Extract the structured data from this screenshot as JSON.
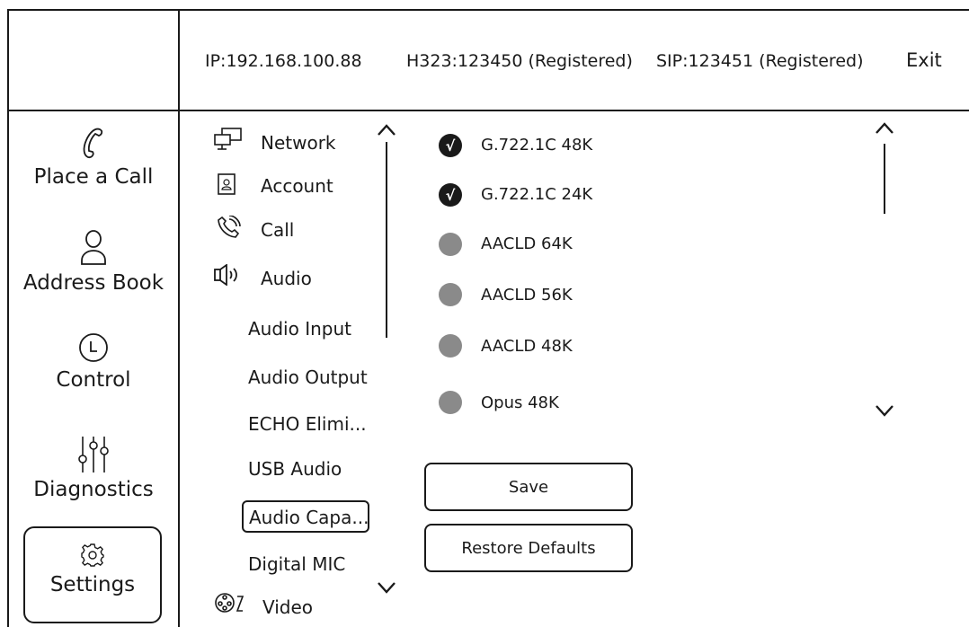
{
  "header": {
    "ip": "IP:192.168.100.88",
    "h323": "H323:123450 (Registered)",
    "sip": "SIP:123451 (Registered)",
    "exit_label": "Exit"
  },
  "nav": {
    "items": [
      {
        "label": "Place a Call",
        "icon": "phone-icon"
      },
      {
        "label": "Address Book",
        "icon": "person-icon"
      },
      {
        "label": "Control",
        "icon": "clock-icon"
      },
      {
        "label": "Diagnostics",
        "icon": "sliders-icon"
      },
      {
        "label": "Settings",
        "icon": "gear-icon",
        "selected": true
      }
    ]
  },
  "submenu": {
    "items": [
      {
        "label": "Network",
        "icon": "network-icon"
      },
      {
        "label": "Account",
        "icon": "account-icon"
      },
      {
        "label": "Call",
        "icon": "call-icon"
      },
      {
        "label": "Audio",
        "icon": "speaker-icon"
      },
      {
        "label": "Audio Input"
      },
      {
        "label": "Audio Output"
      },
      {
        "label": "ECHO Elimi..."
      },
      {
        "label": "USB Audio"
      },
      {
        "label": "Audio Capa...",
        "selected": true
      },
      {
        "label": "Digital MIC"
      },
      {
        "label": "Video",
        "icon": "video-icon"
      }
    ]
  },
  "codecs": {
    "items": [
      {
        "label": "G.722.1C 48K",
        "checked": true
      },
      {
        "label": "G.722.1C 24K",
        "checked": true
      },
      {
        "label": "AACLD 64K",
        "checked": false
      },
      {
        "label": "AACLD 56K",
        "checked": false
      },
      {
        "label": "AACLD 48K",
        "checked": false
      },
      {
        "label": "Opus 48K",
        "checked": false
      }
    ],
    "check_glyph": "√"
  },
  "buttons": {
    "save_label": "Save",
    "restore_label": "Restore Defaults"
  }
}
